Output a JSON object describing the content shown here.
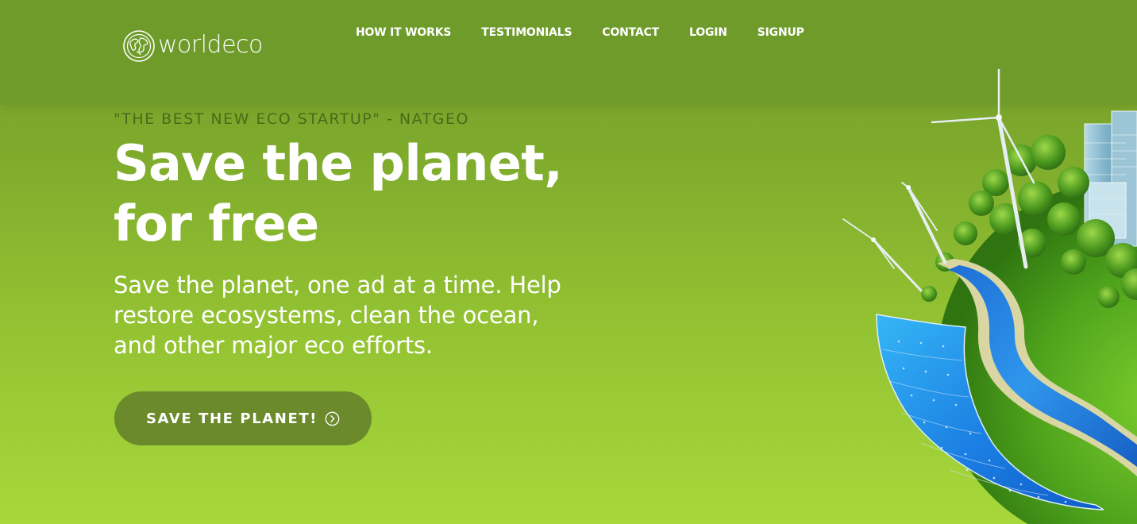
{
  "brand": {
    "name": "worldeco",
    "logo_icon": "globe-icon"
  },
  "nav": {
    "items": [
      {
        "label": "HOW IT WORKS"
      },
      {
        "label": "TESTIMONIALS"
      },
      {
        "label": "CONTACT"
      },
      {
        "label": "LOGIN"
      },
      {
        "label": "SIGNUP"
      }
    ]
  },
  "hero": {
    "quote": "\"THE BEST NEW ECO STARTUP\" - NATGEO",
    "headline_line1": "Save the planet,",
    "headline_line2": "for free",
    "subtext_line1": "Save the planet, one ad at a time. Help",
    "subtext_line2": "restore ecosystems, clean the ocean,",
    "subtext_line3": "and other major eco efforts.",
    "cta_label": "SAVE THE PLANET!",
    "cta_icon": "chevron-right-circle-icon"
  },
  "colors": {
    "nav_bg": "#6e9b2a",
    "hero_top": "#7eaa2c",
    "hero_bottom": "#a6d83a",
    "button_bg": "#6a8a2b",
    "quote_text": "#4a6a19",
    "text": "#ffffff"
  }
}
